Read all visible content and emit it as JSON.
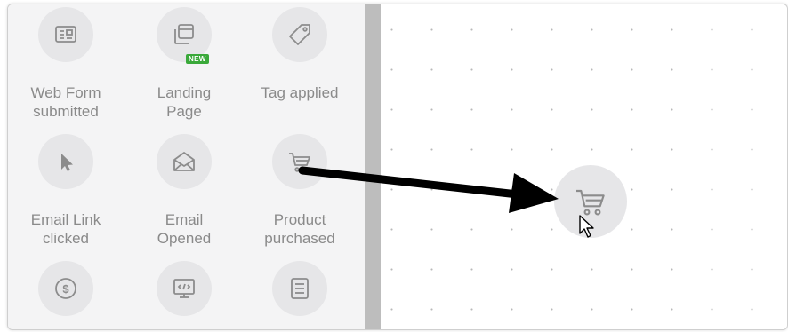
{
  "palette": {
    "items": [
      {
        "label": "",
        "icon": "form-icon"
      },
      {
        "label": "",
        "icon": "landing-page-icon",
        "badge": "NEW"
      },
      {
        "label": "",
        "icon": "tag-icon"
      },
      {
        "label": "Web Form\nsubmitted",
        "icon": "none"
      },
      {
        "label": "Landing\nPage",
        "icon": "none"
      },
      {
        "label": "Tag applied",
        "icon": "none"
      },
      {
        "label": "",
        "icon": "pointer-click-icon"
      },
      {
        "label": "",
        "icon": "envelope-open-icon"
      },
      {
        "label": "",
        "icon": "shopping-cart-icon"
      },
      {
        "label": "Email Link\nclicked",
        "icon": "none"
      },
      {
        "label": "Email\nOpened",
        "icon": "none"
      },
      {
        "label": "Product\npurchased",
        "icon": "none"
      },
      {
        "label": "",
        "icon": "dollar-coin-icon"
      },
      {
        "label": "",
        "icon": "code-monitor-icon"
      },
      {
        "label": "",
        "icon": "document-icon"
      }
    ],
    "labels": {
      "web_form": "Web Form\nsubmitted",
      "landing_page": "Landing\nPage",
      "tag_applied": "Tag applied",
      "email_link": "Email Link\nclicked",
      "email_opened": "Email\nOpened",
      "product_purchased": "Product\npurchased"
    },
    "badge_new": "NEW"
  },
  "canvas": {
    "dropped_node_icon": "shopping-cart-icon",
    "drag_arrow": "black-arrow-icon",
    "cursor": "mouse-pointer-icon"
  },
  "colors": {
    "icon": "#8c8c8c",
    "circle": "#e6e6e8",
    "panel": "#f4f4f5",
    "badge": "#3aa93a",
    "label": "#8a8a8a"
  }
}
